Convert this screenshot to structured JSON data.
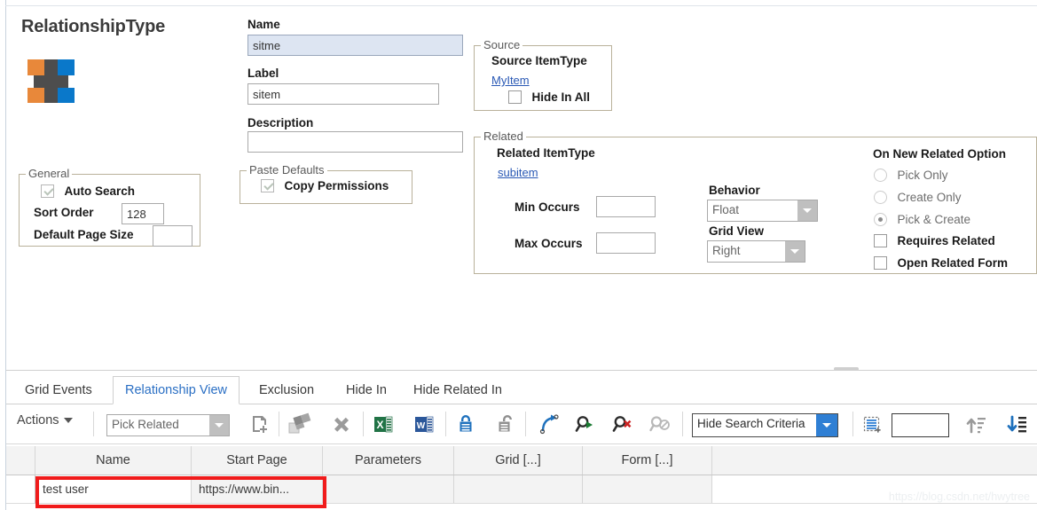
{
  "header": {
    "title": "RelationshipType",
    "logo_icon": "aras-cross-logo-icon"
  },
  "fields": {
    "name_label": "Name",
    "name_value": "sitme",
    "label_label": "Label",
    "label_value": "sitem",
    "description_label": "Description",
    "description_value": ""
  },
  "general": {
    "caption": "General",
    "auto_search_label": "Auto Search",
    "auto_search_checked": true,
    "sort_order_label": "Sort Order",
    "sort_order_value": "128",
    "default_page_size_label": "Default Page Size",
    "default_page_size_value": ""
  },
  "paste_defaults": {
    "caption": "Paste Defaults",
    "copy_permissions_label": "Copy Permissions",
    "copy_permissions_checked": true
  },
  "source": {
    "caption": "Source",
    "source_itemtype_label": "Source ItemType",
    "source_itemtype_value": "MyItem",
    "hide_in_all_label": "Hide In All",
    "hide_in_all_checked": false
  },
  "related": {
    "caption": "Related",
    "related_itemtype_label": "Related ItemType",
    "related_itemtype_value": "subitem",
    "min_occurs_label": "Min Occurs",
    "min_occurs_value": "",
    "max_occurs_label": "Max Occurs",
    "max_occurs_value": "",
    "behavior_label": "Behavior",
    "behavior_value": "Float",
    "grid_view_label": "Grid View",
    "grid_view_value": "Right",
    "on_new_related_option_label": "On New Related Option",
    "pick_only_label": "Pick Only",
    "create_only_label": "Create Only",
    "pick_and_create_label": "Pick & Create",
    "selected_option": "Pick & Create",
    "requires_related_label": "Requires Related",
    "requires_related_checked": false,
    "open_related_form_label": "Open Related Form",
    "open_related_form_checked": false
  },
  "tabs": [
    {
      "label": "Grid Events",
      "active": false
    },
    {
      "label": "Relationship View",
      "active": true
    },
    {
      "label": "Exclusion",
      "active": false
    },
    {
      "label": "Hide In",
      "active": false
    },
    {
      "label": "Hide Related In",
      "active": false
    }
  ],
  "toolbar": {
    "actions_label": "Actions",
    "pick_related_label": "Pick Related",
    "search_criteria_label": "Hide Search Criteria",
    "page_size_value": "",
    "icons": [
      "new-row-icon",
      "relationship-grid-icon",
      "delete-row-icon",
      "export-excel-icon",
      "export-word-icon",
      "lock-icon",
      "unlock-icon",
      "undo-icon",
      "run-search-icon",
      "clear-search-icon",
      "disabled-search-icon",
      "insert-rows-icon",
      "sort-ascending-icon",
      "sort-descending-icon"
    ]
  },
  "grid": {
    "columns": [
      "Name",
      "Start Page",
      "Parameters",
      "Grid [...]",
      "Form [...]"
    ],
    "rows": [
      {
        "Name": "test user",
        "Start Page": "https://www.bin...",
        "Parameters": "",
        "Grid [...]": "",
        "Form [...]": ""
      }
    ]
  },
  "watermark": "https://blog.csdn.net/hwytree",
  "colors": {
    "accent_blue": "#2a6fc4",
    "link_blue": "#2a59b5",
    "highlight_red": "#f01b1b",
    "logo_orange": "#e8883a",
    "logo_blue": "#0a78ca",
    "logo_gray": "#4d4d4d"
  }
}
